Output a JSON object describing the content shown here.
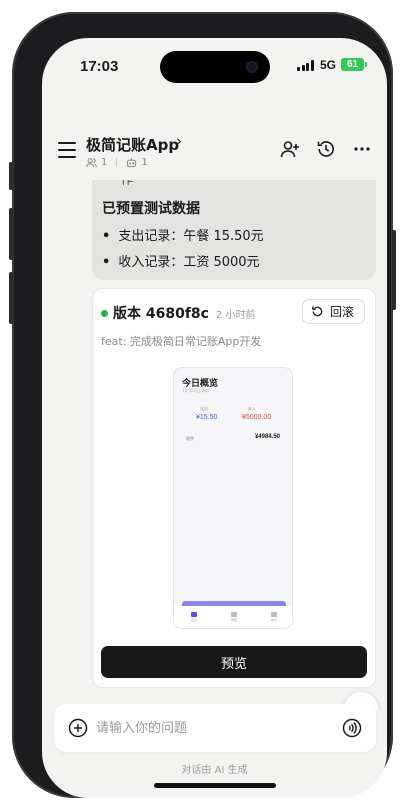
{
  "status_bar": {
    "time": "17:03",
    "network": "5G",
    "battery": "61"
  },
  "header": {
    "title": "极简记账App",
    "title_chevron": "›",
    "members_count": "1",
    "bots_count": "1"
  },
  "chat": {
    "previous_message": {
      "partial_text": "TF",
      "heading": "已预置测试数据",
      "items": [
        "支出记录：午餐 15.50元",
        "收入记录：工资 5000元"
      ]
    },
    "version_card": {
      "version": "版本 4680f8c",
      "time_ago": "2 小时前",
      "rollback_label": "回滚",
      "commit_message": "feat: 完成极简日常记账App开发",
      "thumbnail": {
        "title": "今日概览",
        "date": "10月22日 周二",
        "expense_label": "支出",
        "expense_value": "¥15.50",
        "income_label": "收入",
        "income_value": "¥5000.00",
        "balance_label": "结余",
        "balance_value": "¥4984.50",
        "nav": [
          "首页",
          "明细",
          "统计"
        ]
      },
      "preview_label": "预览"
    }
  },
  "input": {
    "placeholder": "请输入你的问题"
  },
  "footer_note": "对话由 AI 生成",
  "colors": {
    "accent_green": "#21b14f",
    "battery_green": "#34c759",
    "button_dark": "#181818"
  }
}
